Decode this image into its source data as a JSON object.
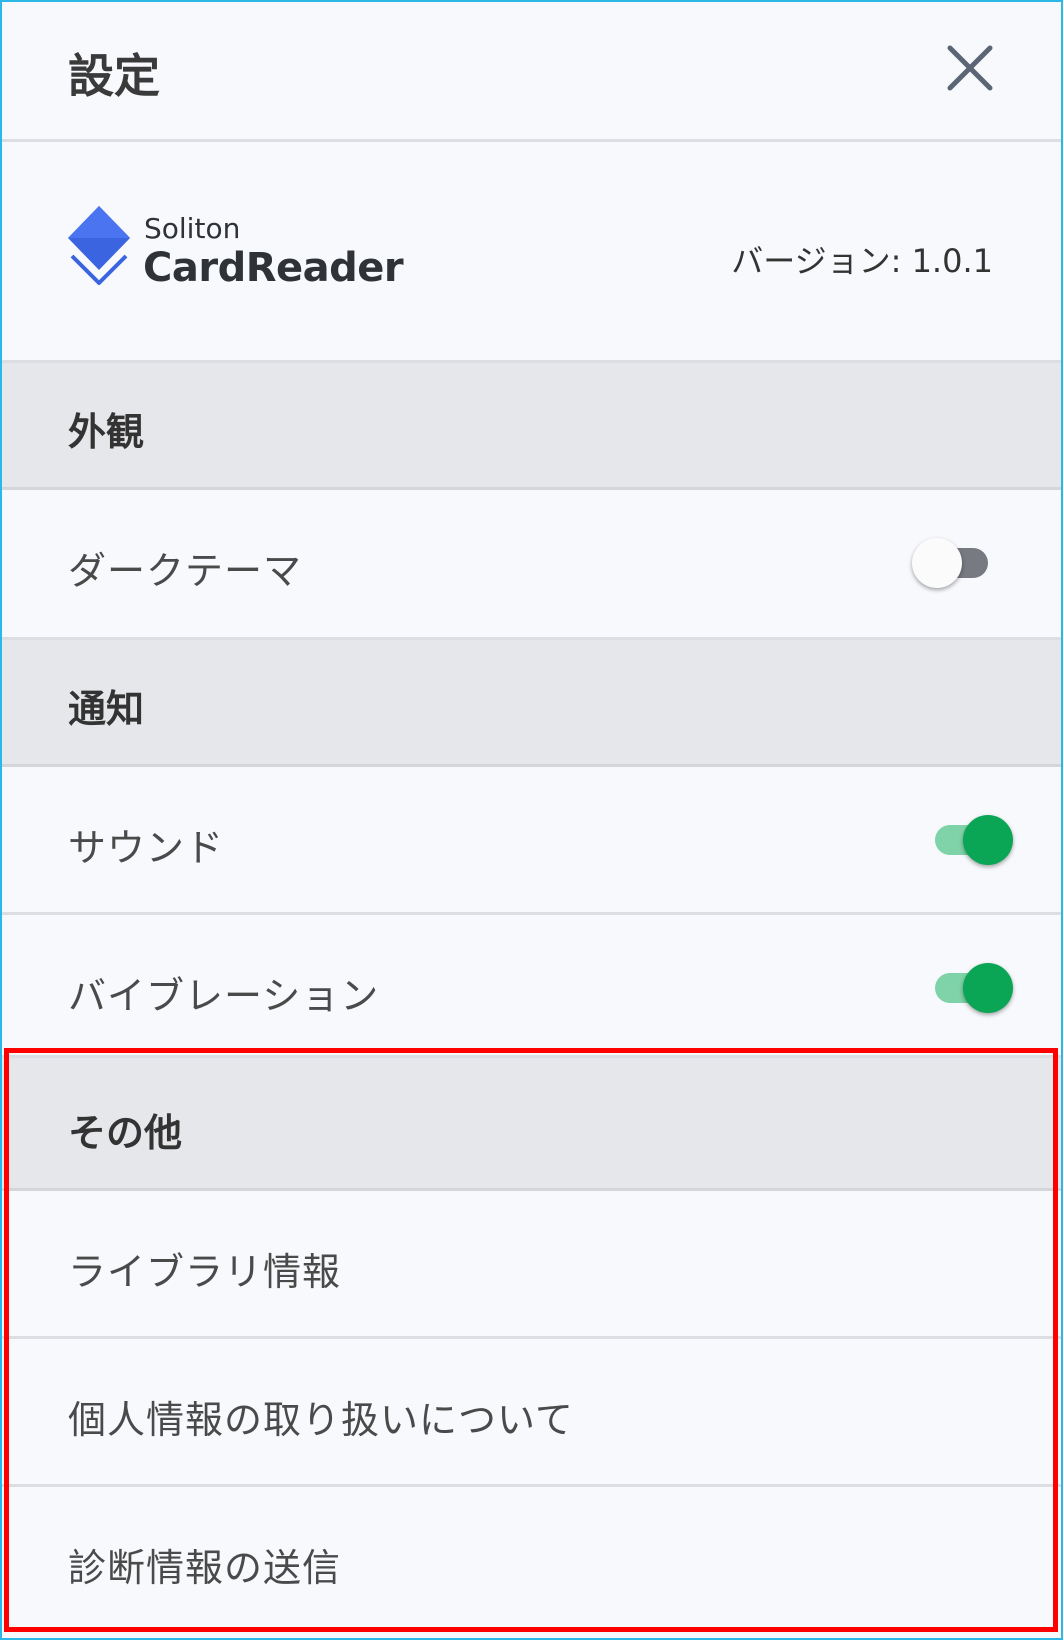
{
  "header": {
    "title": "設定",
    "close_icon": "close-icon"
  },
  "app": {
    "brand_small": "Soliton",
    "brand_name": "CardReader",
    "version": "バージョン: 1.0.1",
    "logo_colors": [
      "#3b64e0",
      "#2748c9"
    ]
  },
  "sections": {
    "appearance": {
      "label": "外観",
      "dark_theme": {
        "label": "ダークテーマ",
        "enabled": false
      }
    },
    "notifications": {
      "label": "通知",
      "sound": {
        "label": "サウンド",
        "enabled": true
      },
      "vibration": {
        "label": "バイブレーション",
        "enabled": true
      }
    },
    "other": {
      "label": "その他",
      "items": [
        "ライブラリ情報",
        "個人情報の取り扱いについて",
        "診断情報の送信"
      ]
    }
  },
  "colors": {
    "accent": "#0aa555",
    "highlight": "#ff0000",
    "frame": "#2bb8e6"
  }
}
